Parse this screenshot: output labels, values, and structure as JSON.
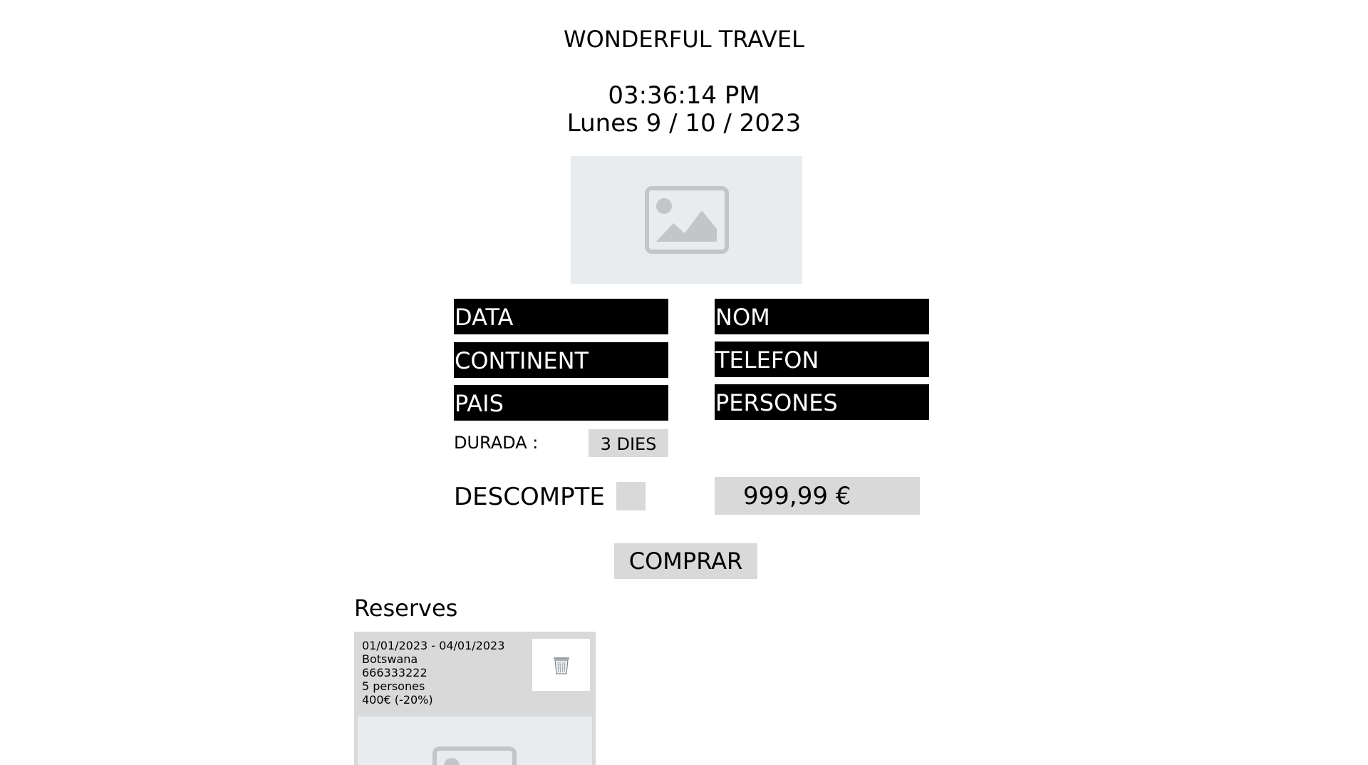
{
  "header": {
    "title": "WONDERFUL TRAVEL",
    "clock": "03:36:14 PM",
    "date": "Lunes 9 / 10 / 2023"
  },
  "hero_image": {
    "icon": "image-placeholder-icon"
  },
  "form": {
    "data_label": "DATA",
    "continent_label": "CONTINENT",
    "pais_label": "PAIS",
    "nom_label": "NOM",
    "telefon_label": "TELEFON",
    "persones_label": "PERSONES",
    "durada_label": "DURADA :",
    "durada_value": "3 DIES",
    "descompte_label": "DESCOMPTE",
    "price": "999,99 €",
    "buy_label": "COMPRAR"
  },
  "reserves": {
    "heading": "Reserves",
    "items": [
      {
        "dates": "01/01/2023 - 04/01/2023",
        "country": "Botswana",
        "phone": "666333222",
        "people": "5 persones",
        "price": "400€ (-20%)",
        "delete_icon": "trash-icon",
        "image_icon": "image-placeholder-icon"
      }
    ]
  },
  "colors": {
    "field_bg": "#000000",
    "field_text": "#ffffff",
    "control_bg": "#d9d9d9",
    "placeholder_bg": "#e8ecef",
    "placeholder_icon": "#c2c6c9"
  }
}
